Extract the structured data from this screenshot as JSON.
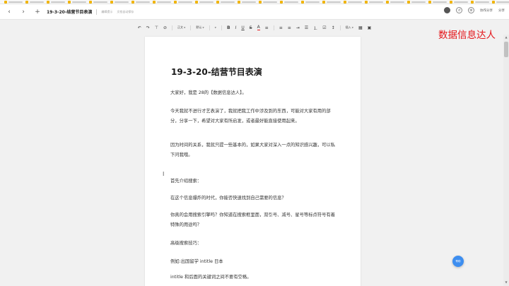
{
  "header": {
    "doc_title": "19-3-20-结营节目表演",
    "edit_status": "编辑提示",
    "meta_text": "文档自动保存",
    "share_label": "协作分享",
    "more_label": "分享"
  },
  "toolbar": {
    "undo": "↶",
    "redo": "↷",
    "format_painter": "⊤",
    "clear_format": "⊘",
    "heading_label": "正文",
    "font_label": "默认",
    "bold": "B",
    "italic": "I",
    "underline": "U",
    "strike": "S",
    "font_color": "A",
    "highlight": "≡",
    "insert_label": "插入"
  },
  "watermark": "数据信息达人",
  "document": {
    "title": "19-3-20-结营节目表演",
    "paragraphs": [
      "大家好，我是 28的【数据信息达人】。",
      "今天我就不进行才艺表演了，我就把我工作中涉及到的东西，可能对大家有用的部分，分享一下，希望对大家有所启发，或者最好能直接使用起来。",
      "因为时间的关系，我就只提一些基本的，如果大家对深入一点的知识感兴趣，可以私下问我哦。",
      "首先介绍搜索：",
      "在这个信息爆炸的时代，你能否快速找到自己需要的信息？",
      "你真的会用搜索引擎吗？你知道在搜索框里面，双引号、减号、星号等标点符号有着特殊的用途吗？",
      "高级搜索技巧：",
      "例如:出国留学 intitle 日本",
      "intitle 和后面的关键词之间不要有空格。"
    ]
  },
  "help_label": "帮助"
}
